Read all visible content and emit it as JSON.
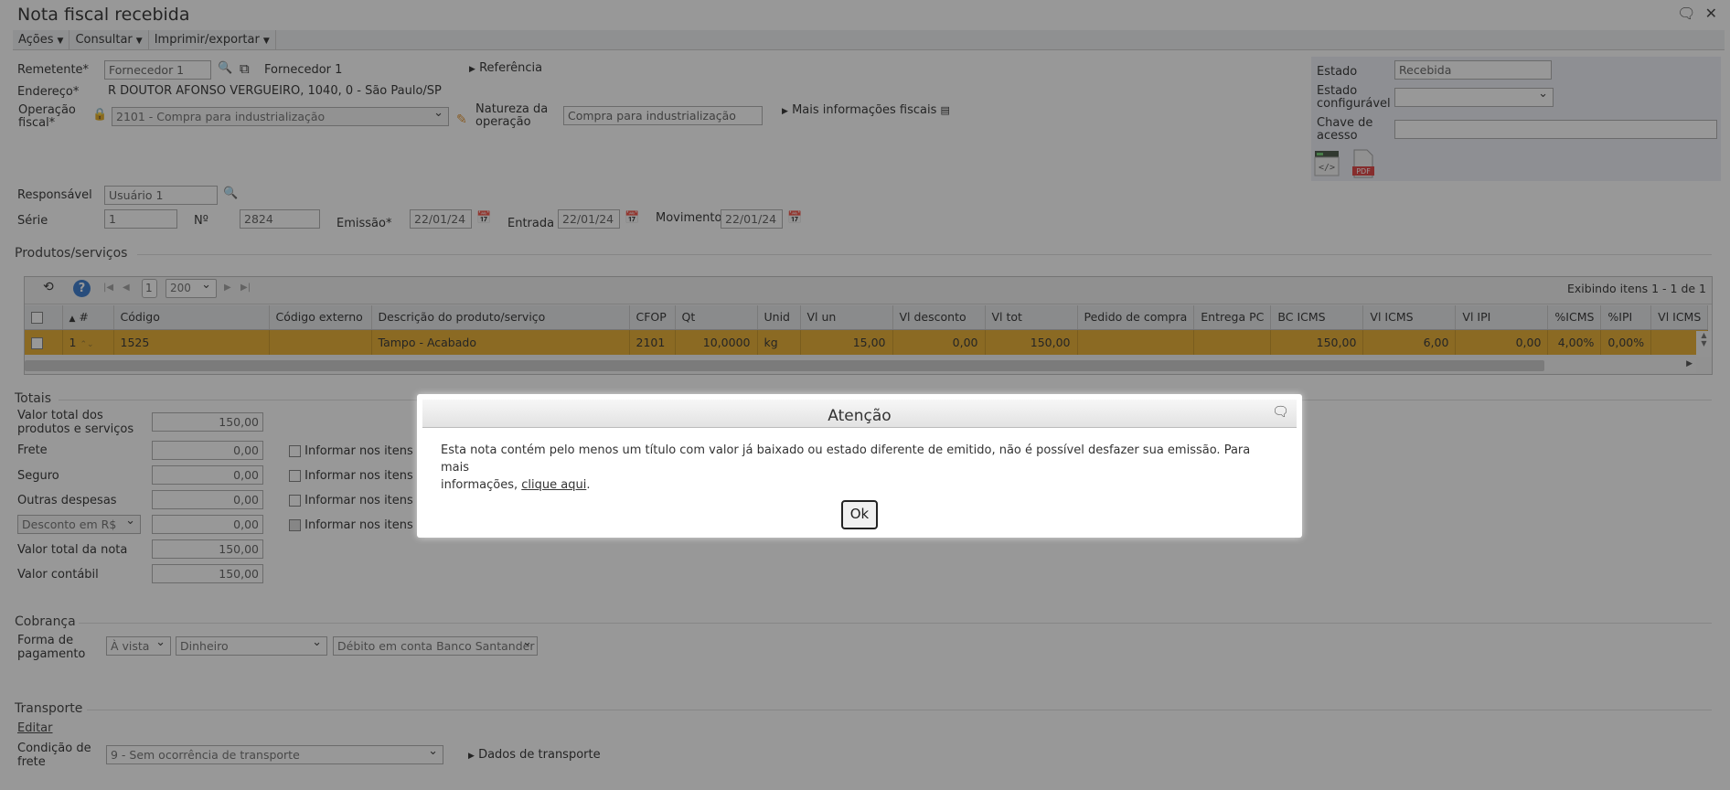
{
  "window": {
    "title": "Nota fiscal recebida"
  },
  "menu": [
    {
      "label": "Ações"
    },
    {
      "label": "Consultar"
    },
    {
      "label": "Imprimir/exportar"
    }
  ],
  "header": {
    "remetente_label": "Remetente*",
    "remetente_value": "Fornecedor 1",
    "remetente_name": "Fornecedor 1",
    "referencia_label": "Referência",
    "endereco_label": "Endereço*",
    "endereco_value": "R DOUTOR AFONSO VERGUEIRO, 1040, 0 - São Paulo/SP",
    "operacao_label_1": "Operação",
    "operacao_label_2": "fiscal*",
    "operacao_value": "2101 - Compra para industrialização",
    "natureza_label_1": "Natureza da",
    "natureza_label_2": "operação",
    "natureza_value": "Compra para industrialização",
    "mais_info_label": "Mais informações fiscais",
    "responsavel_label": "Responsável",
    "responsavel_value": "Usuário 1",
    "serie_label": "Série",
    "serie_value": "1",
    "numero_label": "Nº",
    "numero_value": "2824",
    "emissao_label": "Emissão*",
    "emissao_value": "22/01/24",
    "entrada_label": "Entrada",
    "entrada_value": "22/01/24",
    "movimento_label": "Movimento",
    "movimento_value": "22/01/24"
  },
  "state_panel": {
    "estado_label": "Estado",
    "estado_value": "Recebida",
    "estado_config_label_1": "Estado",
    "estado_config_label_2": "configurável",
    "estado_config_value": "",
    "chave_label_1": "Chave de",
    "chave_label_2": "acesso",
    "chave_value": "",
    "pdf_label": "PDF"
  },
  "products": {
    "section_title": "Produtos/serviços",
    "page": "1",
    "page_size": "200",
    "summary": "Exibindo itens 1 - 1 de 1",
    "columns": [
      "#",
      "Código",
      "Código externo",
      "Descrição do produto/serviço",
      "CFOP",
      "Qt",
      "Unid",
      "Vl un",
      "Vl desconto",
      "Vl tot",
      "Pedido de compra",
      "Entrega PC",
      "BC ICMS",
      "Vl ICMS",
      "Vl IPI",
      "%ICMS",
      "%IPI",
      "Vl ICMS"
    ],
    "rows": [
      {
        "num": "1",
        "codigo": "1525",
        "codigo_externo": "",
        "descricao": "Tampo - Acabado",
        "cfop": "2101",
        "qt": "10,0000",
        "unid": "kg",
        "vl_un": "15,00",
        "vl_desconto": "0,00",
        "vl_tot": "150,00",
        "pedido": "",
        "entrega": "",
        "bc_icms": "150,00",
        "vl_icms": "6,00",
        "vl_ipi": "0,00",
        "pct_icms": "4,00%",
        "pct_ipi": "0,00%",
        "vl_icms2": ""
      }
    ]
  },
  "totais": {
    "section_title": "Totais",
    "valor_produtos_label_1": "Valor total dos",
    "valor_produtos_label_2": "produtos e serviços",
    "valor_produtos": "150,00",
    "frete_label": "Frete",
    "frete": "0,00",
    "seguro_label": "Seguro",
    "seguro": "0,00",
    "outras_label": "Outras despesas",
    "outras": "0,00",
    "desconto_select": "Desconto em R$",
    "desconto": "0,00",
    "informar_label": "Informar nos itens",
    "valor_nota_label": "Valor total da nota",
    "valor_nota": "150,00",
    "valor_contabil_label": "Valor contábil",
    "valor_contabil": "150,00"
  },
  "cobranca": {
    "section_title": "Cobrança",
    "forma_label_1": "Forma de",
    "forma_label_2": "pagamento",
    "prazo": "À vista",
    "meio": "Dinheiro",
    "conta": "Débito em conta Banco Santander"
  },
  "transporte": {
    "section_title": "Transporte",
    "editar": "Editar",
    "condicao_label_1": "Condição de",
    "condicao_label_2": "frete",
    "condicao_value": "9 - Sem ocorrência de transporte",
    "dados_label": "Dados de transporte"
  },
  "dialog": {
    "title": "Atenção",
    "message_1": "Esta nota contém pelo menos um título com valor já baixado ou estado diferente de emitido, não é possível desfazer sua emissão. Para mais",
    "message_2": "informações,",
    "link": "clique aqui",
    "message_end": ".",
    "ok": "Ok"
  }
}
